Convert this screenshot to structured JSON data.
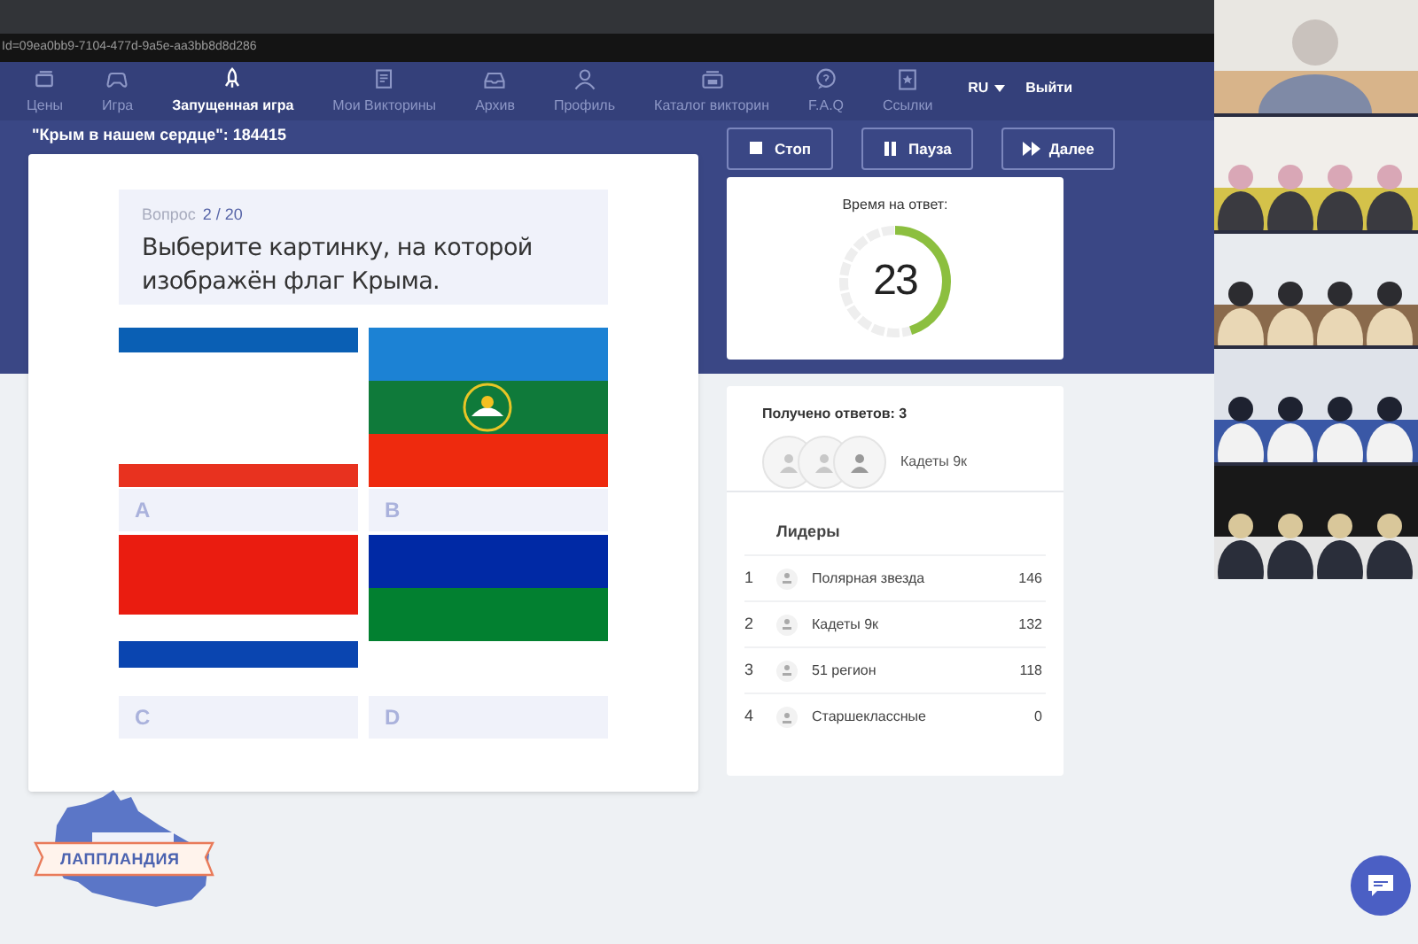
{
  "browser": {
    "url": "Id=09ea0bb9-7104-477d-9a5e-aa3bb8d8d286"
  },
  "nav": {
    "items": [
      {
        "label": "Цены",
        "selected": false
      },
      {
        "label": "Игра",
        "selected": false
      },
      {
        "label": "Запущенная игра",
        "selected": true
      },
      {
        "label": "Мои Викторины",
        "selected": false
      },
      {
        "label": "Архив",
        "selected": false
      },
      {
        "label": "Профиль",
        "selected": false
      },
      {
        "label": "Каталог викторин",
        "selected": false
      },
      {
        "label": "F.A.Q",
        "selected": false
      },
      {
        "label": "Ссылки",
        "selected": false
      }
    ],
    "language": "RU",
    "logout": "Выйти"
  },
  "game_title": "\"Крым в нашем сердце\": 184415",
  "question": {
    "label": "Вопрос",
    "counter": "2 / 20",
    "text": "Выберите картинку, на которой изображён флаг Крыма."
  },
  "options": [
    {
      "label": "A",
      "kind": "picture"
    },
    {
      "label": "B",
      "kind": "picture"
    },
    {
      "label": "C",
      "kind": "picture"
    },
    {
      "label": "D",
      "kind": "picture"
    }
  ],
  "controls": [
    {
      "label": "Стоп",
      "kind": "stop"
    },
    {
      "label": "Пауза",
      "kind": "pause"
    },
    {
      "label": "Далее",
      "kind": "next"
    }
  ],
  "timer": {
    "title": "Время на ответ:",
    "value": "23",
    "level": 0.45
  },
  "answers": {
    "title": "Получено ответов: 3",
    "last_team": "Кадеты 9к"
  },
  "leaders": {
    "title": "Лидеры",
    "rows": [
      {
        "rank": "1",
        "name": "Полярная звезда",
        "score": "146"
      },
      {
        "rank": "2",
        "name": "Кадеты 9к",
        "score": "132"
      },
      {
        "rank": "3",
        "name": "51 регион",
        "score": "118"
      },
      {
        "rank": "4",
        "name": "Старшеклассные",
        "score": "0"
      }
    ]
  },
  "logo": {
    "text": "ЛАППЛАНДИЯ"
  }
}
